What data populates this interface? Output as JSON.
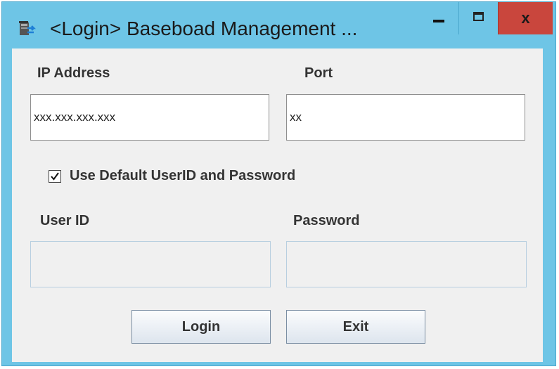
{
  "window": {
    "title": "<Login> Baseboad Management ...",
    "accent": "#6ec5e6",
    "close_color": "#c9463d"
  },
  "controls": {
    "minimize_icon": "minimize-icon",
    "maximize_icon": "maximize-icon",
    "close_icon": "close-icon",
    "close_glyph": "x"
  },
  "form": {
    "ip_label": "IP Address",
    "ip_value": "xxx.xxx.xxx.xxx",
    "port_label": "Port",
    "port_value": "xx",
    "checkbox_checked": true,
    "checkbox_label": "Use Default UserID and Password",
    "userid_label": "User ID",
    "userid_value": "",
    "password_label": "Password",
    "password_value": ""
  },
  "buttons": {
    "login_label": "Login",
    "exit_label": "Exit"
  }
}
